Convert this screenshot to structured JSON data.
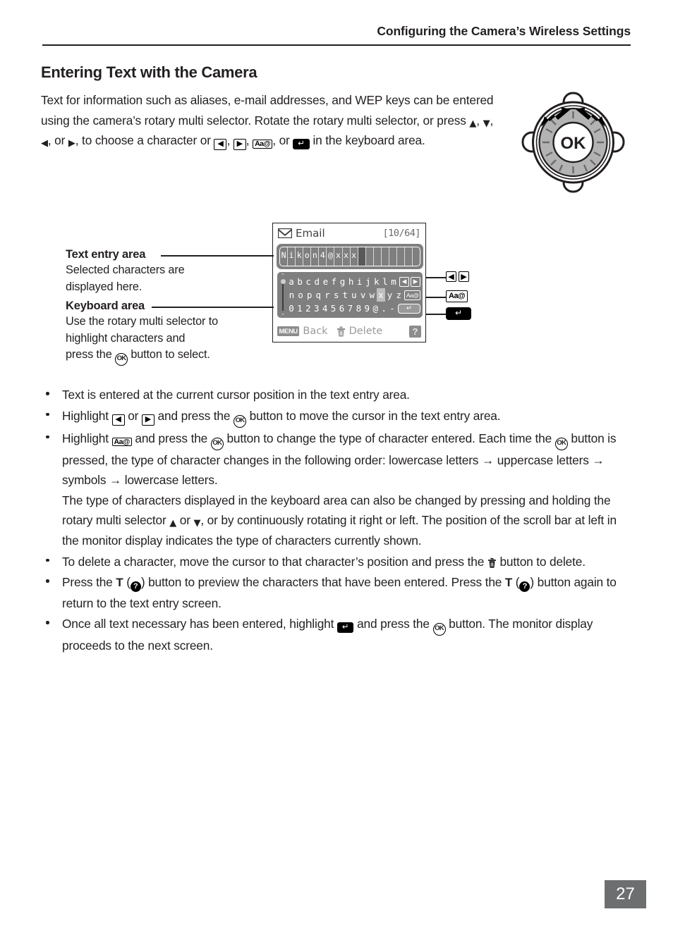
{
  "header": {
    "title": "Configuring the Camera’s Wireless Settings"
  },
  "page_title": "Entering Text with the Camera",
  "intro": {
    "line1": "Text for information such as aliases, e-mail addresses, and WEP keys",
    "line2": "can be entered using the camera’s rotary multi selector. Rotate the",
    "line3_a": "rotary multi selector, or press ",
    "line3_b": ", to choose a character",
    "line4_a": "or ",
    "line4_b": " in the keyboard area.",
    "up_arrow": "▲",
    "down_arrow": "▼",
    "left_arrow": "◀",
    "right_arrow": "▶",
    "left_key": "◀",
    "right_key": "▶",
    "aa_key": "Aa@",
    "enter_key": "↵",
    "sep": ", ",
    "or_text": ", or "
  },
  "rotary_selector": {
    "center_label": "OK",
    "icon": "rotary-multi-selector-icon"
  },
  "monitor": {
    "envelope_icon": "envelope-icon",
    "title": "Email",
    "counter": "[10/64]",
    "text_entry": {
      "value": "Nikon4@xxx",
      "characters": [
        "N",
        "i",
        "k",
        "o",
        "n",
        "4",
        "@",
        "x",
        "x",
        "x"
      ],
      "cursor_index": 10,
      "total_cells": 18
    },
    "keyboard": {
      "rows": [
        {
          "chars": [
            "a",
            "b",
            "c",
            "d",
            "e",
            "f",
            "g",
            "h",
            "i",
            "j",
            "k",
            "l",
            "m"
          ],
          "side": [
            "◀",
            "▶"
          ],
          "side_type": "arrows"
        },
        {
          "chars": [
            "n",
            "o",
            "p",
            "q",
            "r",
            "s",
            "t",
            "u",
            "v",
            "w",
            "x",
            "y",
            "z"
          ],
          "side": [
            "Aa@"
          ],
          "side_type": "aa"
        },
        {
          "chars": [
            "0",
            "1",
            "2",
            "3",
            "4",
            "5",
            "6",
            "7",
            "8",
            "9",
            "@",
            ".",
            "-"
          ],
          "side": [
            "↵"
          ],
          "side_type": "enter"
        }
      ],
      "selected_char": "x",
      "selected_row": 1,
      "selected_col": 10,
      "scrollbar": {
        "up_chevron": "⌃",
        "down_chevron": "⌄",
        "thumb_position": "top"
      }
    },
    "bottom_bar": {
      "menu_badge": "MENU",
      "back_label": "Back",
      "trash_icon": "trash-icon",
      "delete_label": "Delete",
      "help_badge": "?"
    }
  },
  "callouts": [
    {
      "title": "Text entry area",
      "body_line1": "Selected characters are",
      "body_line2": "displayed here."
    },
    {
      "title": "Keyboard area",
      "body_line1": "Use the rotary multi selector to",
      "body_line2_a": "highlight characters and",
      "body_line3_a": "press the ",
      "body_line3_b": " button to select.",
      "ok_label": "OK"
    }
  ],
  "right_callouts": {
    "row1": [
      "◀",
      "▶"
    ],
    "row2": "Aa@",
    "row3": "↵"
  },
  "bullets": {
    "b1": "Text is entered at the current cursor position in the text entry area.",
    "b2_a": "Highlight ",
    "b2_b": " or ",
    "b2_c": " and press the ",
    "b2_d": " button to move the cursor in the text entry area.",
    "b3_a": "Highlight ",
    "b3_b": " and press the ",
    "b3_c": " button to change the type of character entered. Each time the ",
    "b3_d": " button is pressed, the type of character changes in the following order: lowercase letters → uppercase letters → symbols → lowercase letters.",
    "b3_e": "The type of characters displayed in the keyboard area can also be changed by pressing and holding the rotary multi selector ",
    "b3_f": " or ",
    "b3_g": ", or by continuously rotating it right or left. The position of the scroll bar at left in the monitor display indicates the type of characters currently shown.",
    "b4_a": "To delete a character, move the cursor to that character’s position and press the ",
    "b4_b": " button to delete.",
    "b5_a": "Press the ",
    "b5_T": "T",
    "b5_b": " (",
    "b5_c": ") button to preview the characters that have been entered. Press the ",
    "b5_T2": "T",
    "b5_d": " (",
    "b5_e": ") button again to return to the text entry screen.",
    "b6_a": "Once all text necessary has been entered, highlight ",
    "b6_b": " and press the ",
    "b6_c": " button. The monitor display proceeds to the next screen."
  },
  "glyphs": {
    "up_triangle": "▲",
    "down_triangle": "▼",
    "left_triangle": "◀",
    "right_triangle": "▶",
    "enter": "↵",
    "ok": "OK",
    "aa": "Aa@",
    "help": "?",
    "arrow_right": "→"
  },
  "footer": {
    "page_number": "27"
  },
  "colors": {
    "text": "#231f20",
    "monitor_gray": "#7f7f7f",
    "page_badge": "#6d6e70",
    "selection": "#bfbfbf"
  }
}
